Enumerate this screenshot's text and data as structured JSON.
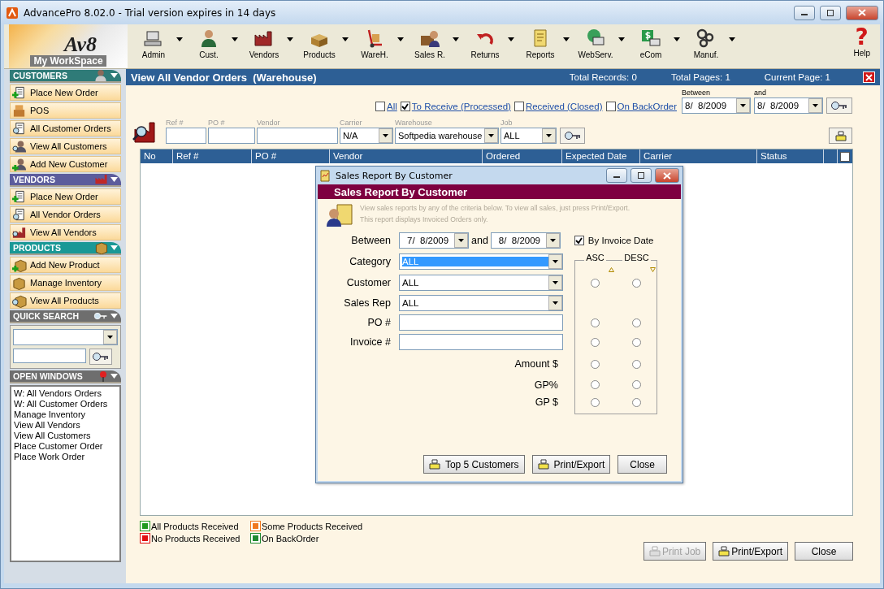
{
  "window": {
    "title": "AdvancePro 8.02.0 - Trial version expires in 14 days"
  },
  "toolbar": {
    "logo": {
      "mark": "Av8",
      "caption": "My WorkSpace"
    },
    "items": [
      {
        "label": "Admin"
      },
      {
        "label": "Cust."
      },
      {
        "label": "Vendors"
      },
      {
        "label": "Products"
      },
      {
        "label": "WareH."
      },
      {
        "label": "Sales R."
      },
      {
        "label": "Returns"
      },
      {
        "label": "Reports"
      },
      {
        "label": "WebServ."
      },
      {
        "label": "eCom"
      },
      {
        "label": "Manuf."
      }
    ],
    "help": {
      "icon": "?",
      "label": "Help"
    }
  },
  "sidebar": {
    "sections": [
      {
        "title": "CUSTOMERS",
        "color": "#2f7b78",
        "items": [
          "Place New Order",
          "POS",
          "All Customer Orders",
          "View All Customers",
          "Add New Customer"
        ]
      },
      {
        "title": "VENDORS",
        "color": "#5c5c9c",
        "items": [
          "Place New Order",
          "All Vendor Orders",
          "View All Vendors"
        ]
      },
      {
        "title": "PRODUCTS",
        "color": "#1a9896",
        "items": [
          "Add New Product",
          "Manage Inventory",
          "View All Products"
        ]
      }
    ],
    "quick_search": {
      "title": "QUICK SEARCH"
    },
    "open_windows": {
      "title": "OPEN WINDOWS",
      "items": [
        "W: All Vendors Orders",
        "W: All Customer Orders",
        "Manage Inventory",
        "View All Vendors",
        "View All Customers",
        "Place Customer Order",
        "Place Work Order"
      ]
    }
  },
  "panel": {
    "title": "View All Vendor Orders  (Warehouse)",
    "stats": [
      {
        "label": "Total Records:",
        "value": "0"
      },
      {
        "label": "Total Pages:",
        "value": "1"
      },
      {
        "label": "Current Page:",
        "value": "1"
      }
    ],
    "status_filters": [
      {
        "label": "All",
        "checked": false
      },
      {
        "label": "To Receive (Processed)",
        "checked": true
      },
      {
        "label": "Received (Closed)",
        "checked": false
      },
      {
        "label": "On BackOrder",
        "checked": false
      }
    ],
    "date_range": {
      "from_label": "Between",
      "from": "8/  8/2009",
      "to_label": "and",
      "to": "8/  8/2009"
    },
    "search_fields": [
      {
        "label": "Ref #",
        "kind": "text"
      },
      {
        "label": "PO #",
        "kind": "text"
      },
      {
        "label": "Vendor",
        "kind": "text"
      },
      {
        "label": "Carrier",
        "kind": "combo",
        "value": "N/A"
      },
      {
        "label": "Warehouse",
        "kind": "combo",
        "value": "Softpedia warehouse"
      },
      {
        "label": "Job",
        "kind": "combo",
        "value": "ALL"
      }
    ],
    "table": {
      "columns": [
        "No",
        "Ref #",
        "PO #",
        "Vendor",
        "Ordered",
        "Expected Date",
        "Carrier",
        "Status"
      ],
      "select_all": {
        "checked": false
      }
    },
    "legend": [
      {
        "label": "All Products Received",
        "color": "#1f9a1f"
      },
      {
        "label": "Some Products Received",
        "color": "#f07820"
      },
      {
        "label": "No Products Received",
        "color": "#e01010"
      },
      {
        "label": "On BackOrder",
        "color": "#208a30"
      }
    ],
    "buttons": [
      {
        "label": "Print Job",
        "kind": "print",
        "disabled": true
      },
      {
        "label": "Print/Export",
        "kind": "print",
        "disabled": false
      },
      {
        "label": "Close",
        "kind": "plain",
        "disabled": false
      }
    ]
  },
  "dialog": {
    "title": "Sales Report By Customer",
    "heading": "Sales Report By Customer",
    "info": [
      "View sales reports by any of the criteria below.  To view all sales, just press Print/Export.",
      "This report displays Invoiced Orders only."
    ],
    "between": {
      "label": "Between",
      "from": "7/  8/2009",
      "and": "and",
      "to": "8/  8/2009"
    },
    "by_invoice_date": {
      "label": "By Invoice Date",
      "checked": true
    },
    "fields": [
      {
        "label": "Category",
        "kind": "combo",
        "value": "ALL",
        "selected": true
      },
      {
        "label": "Customer",
        "kind": "combo",
        "value": "ALL",
        "selected": false
      },
      {
        "label": "Sales Rep",
        "kind": "combo",
        "value": "ALL",
        "selected": false
      },
      {
        "label": "PO #",
        "kind": "text",
        "selected": false
      },
      {
        "label": "Invoice #",
        "kind": "text",
        "selected": false
      }
    ],
    "sort": {
      "asc_label": "ASC",
      "desc_label": "DESC",
      "rows": [
        {
          "asc_selected": false,
          "desc_selected": false
        },
        {
          "asc_selected": false,
          "desc_selected": false
        },
        {
          "asc_selected": false,
          "desc_selected": false
        },
        {
          "label": "Amount $",
          "asc_selected": false,
          "desc_selected": false
        },
        {
          "label": "GP%",
          "asc_selected": false,
          "desc_selected": false
        },
        {
          "label": "GP $",
          "asc_selected": false,
          "desc_selected": false
        }
      ]
    },
    "buttons": [
      {
        "label": "Top 5 Customers",
        "kind": "print"
      },
      {
        "label": "Print/Export",
        "kind": "print"
      },
      {
        "label": "Close",
        "kind": "plain"
      }
    ]
  }
}
